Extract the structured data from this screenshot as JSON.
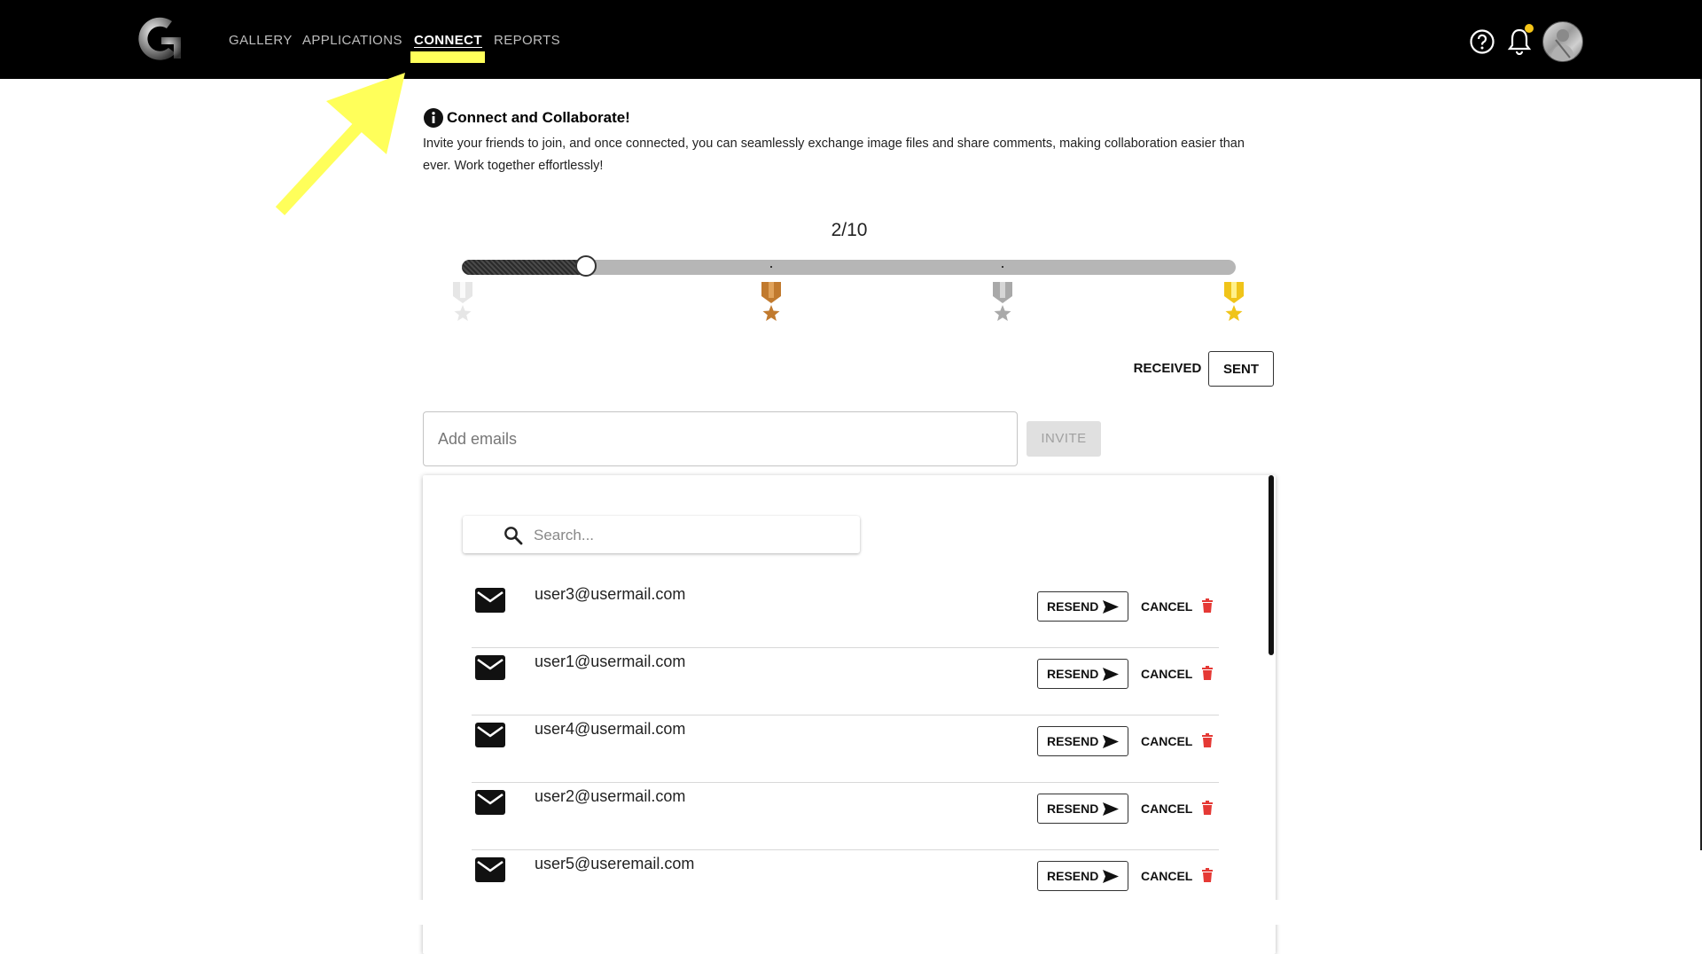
{
  "nav": {
    "items": [
      {
        "label": "GALLERY"
      },
      {
        "label": "APPLICATIONS"
      },
      {
        "label": "CONNECT"
      },
      {
        "label": "REPORTS"
      }
    ],
    "active": "CONNECT"
  },
  "intro": {
    "title": "Connect and Collaborate!",
    "text": "Invite your friends to join, and once connected, you can seamlessly exchange image files and share comments, making collaboration easier than ever. Work together effortlessly!"
  },
  "progress": {
    "label": "2/10",
    "current": 2,
    "total": 10,
    "medals": [
      {
        "name": "medal-white-icon",
        "color": "#e6e6e6"
      },
      {
        "name": "medal-bronze-icon",
        "color": "#c17a2e"
      },
      {
        "name": "medal-silver-icon",
        "color": "#a9a9a9"
      },
      {
        "name": "medal-gold-icon",
        "color": "#f0c419"
      }
    ]
  },
  "toggle": {
    "received": "RECEIVED",
    "sent": "SENT",
    "selected": "SENT"
  },
  "invite": {
    "placeholder": "Add emails",
    "button": "INVITE"
  },
  "search": {
    "placeholder": "Search..."
  },
  "sent_invites": [
    {
      "email": "user3@usermail.com",
      "resend": "RESEND",
      "cancel": "CANCEL"
    },
    {
      "email": "user1@usermail.com",
      "resend": "RESEND",
      "cancel": "CANCEL"
    },
    {
      "email": "user4@usermail.com",
      "resend": "RESEND",
      "cancel": "CANCEL"
    },
    {
      "email": "user2@usermail.com",
      "resend": "RESEND",
      "cancel": "CANCEL"
    },
    {
      "email": "user5@useremail.com",
      "resend": "RESEND",
      "cancel": "CANCEL"
    }
  ],
  "colors": {
    "topbar": "#000000",
    "highlight": "#ffff5a",
    "notification_dot": "#f5c518",
    "delete_red": "#e53935"
  }
}
